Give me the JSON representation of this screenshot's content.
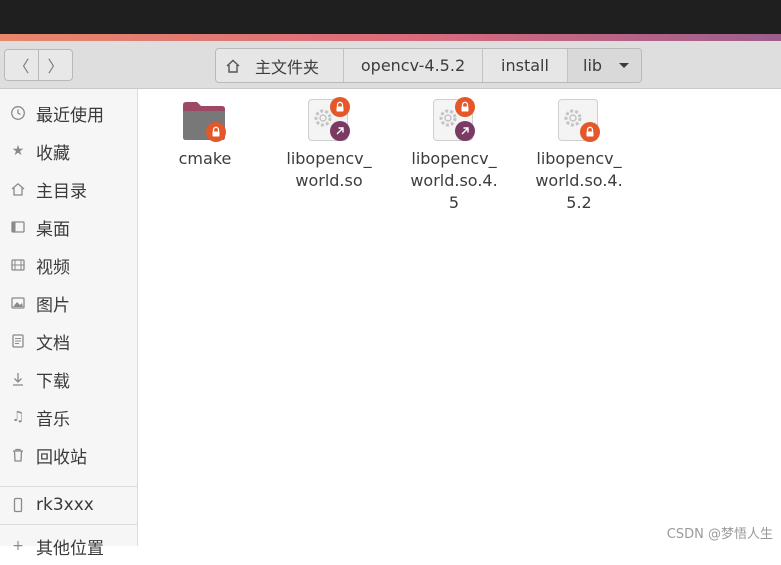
{
  "header": {
    "nav": {
      "back": "〈",
      "forward": "〉"
    },
    "breadcrumbs": [
      "主文件夹",
      "opencv-4.5.2",
      "install",
      "lib"
    ]
  },
  "sidebar": {
    "items": [
      {
        "label": "最近使用",
        "icon": "clock-icon"
      },
      {
        "label": "收藏",
        "icon": "star-icon"
      },
      {
        "label": "主目录",
        "icon": "home-icon"
      },
      {
        "label": "桌面",
        "icon": "desktop-icon"
      },
      {
        "label": "视频",
        "icon": "video-icon"
      },
      {
        "label": "图片",
        "icon": "picture-icon"
      },
      {
        "label": "文档",
        "icon": "document-icon"
      },
      {
        "label": "下载",
        "icon": "download-icon"
      },
      {
        "label": "音乐",
        "icon": "music-icon"
      },
      {
        "label": "回收站",
        "icon": "trash-icon"
      }
    ],
    "devices": [
      {
        "label": "rk3xxx",
        "icon": "phone-icon"
      }
    ],
    "other": {
      "label": "其他位置",
      "icon": "plus-icon"
    }
  },
  "files": [
    {
      "name": "cmake",
      "kind": "folder",
      "locked": true,
      "link": false
    },
    {
      "name": "libopencv_world.so",
      "kind": "library",
      "locked": true,
      "link": true
    },
    {
      "name": "libopencv_world.so.4.5",
      "kind": "library",
      "locked": true,
      "link": true
    },
    {
      "name": "libopencv_world.so.4.5.2",
      "kind": "library",
      "locked": true,
      "link": false
    }
  ],
  "watermark": "CSDN @梦悟人生",
  "colors": {
    "accent": "#e3572b",
    "link_badge": "#7a3a63",
    "folder": "#7a7a7a"
  }
}
